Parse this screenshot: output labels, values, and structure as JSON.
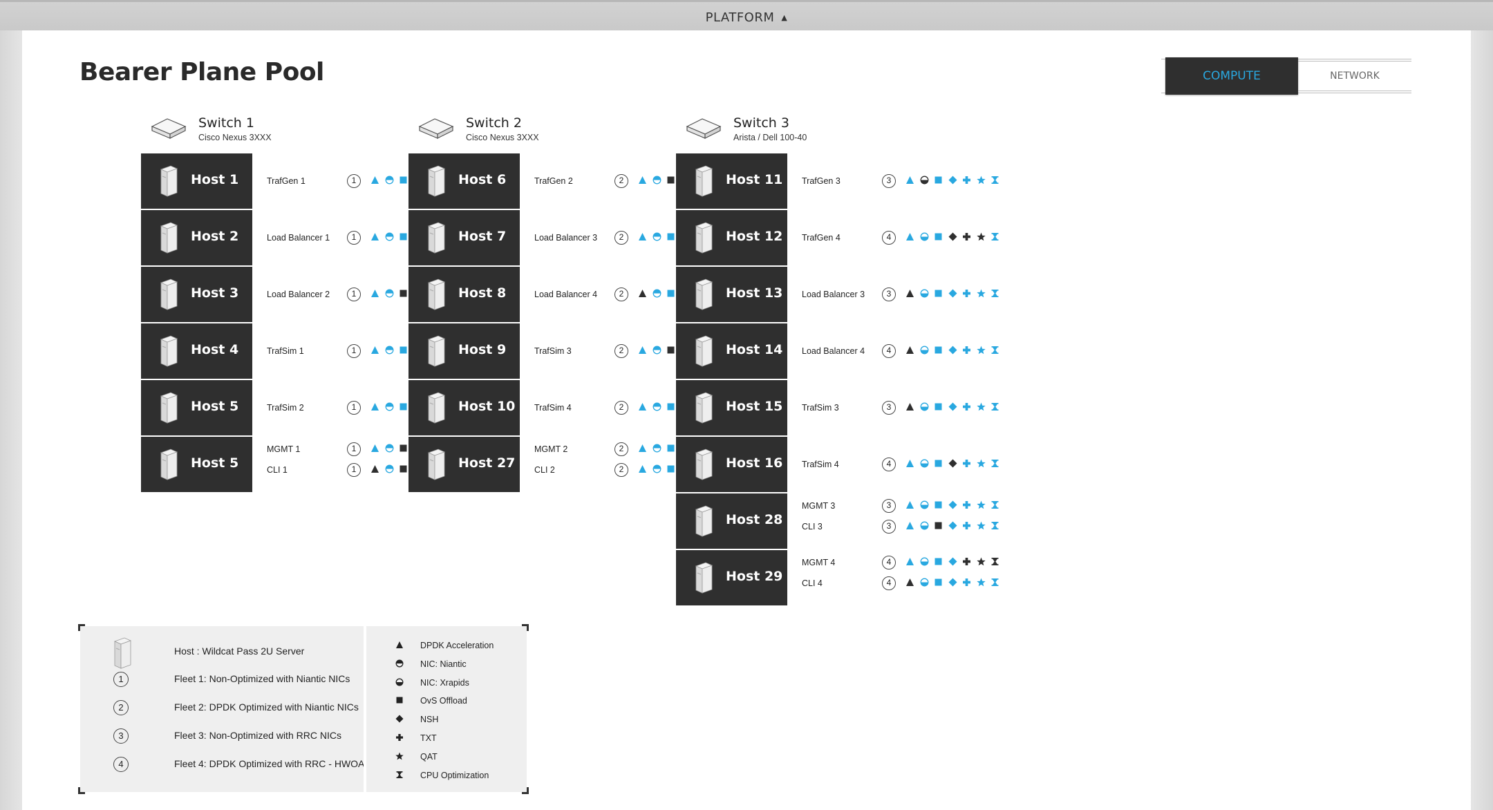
{
  "header": {
    "title": "PLATFORM",
    "caret_icon": "caret-up-icon"
  },
  "page": {
    "title": "Bearer Plane Pool"
  },
  "view_toggle": {
    "compute_label": "COMPUTE",
    "network_label": "NETWORK",
    "active": "COMPUTE"
  },
  "colors": {
    "accent": "#29a8e0",
    "dark": "#2f2f2f"
  },
  "capability_order": [
    "dpdk",
    "niantic",
    "square",
    "diamond",
    "plus",
    "star",
    "hourglass"
  ],
  "switches": [
    {
      "name": "Switch 1",
      "model": "Cisco Nexus 3XXX",
      "hosts": [
        {
          "name": "Host 1",
          "lines": [
            {
              "label": "TrafGen 1",
              "fleet": "1",
              "nic": "niantic",
              "dark": [
                3
              ]
            }
          ]
        },
        {
          "name": "Host 2",
          "lines": [
            {
              "label": "Load Balancer 1",
              "fleet": "1",
              "nic": "niantic",
              "dark": [
                3,
                6
              ]
            }
          ]
        },
        {
          "name": "Host 3",
          "lines": [
            {
              "label": "Load Balancer 2",
              "fleet": "1",
              "nic": "niantic",
              "dark": [
                2,
                3
              ]
            }
          ]
        },
        {
          "name": "Host 4",
          "lines": [
            {
              "label": "TrafSim 1",
              "fleet": "1",
              "nic": "niantic",
              "dark": [
                4
              ]
            }
          ]
        },
        {
          "name": "Host 5",
          "lines": [
            {
              "label": "TrafSim 2",
              "fleet": "1",
              "nic": "niantic",
              "dark": []
            }
          ]
        },
        {
          "name": "Host 5",
          "lines": [
            {
              "label": "MGMT 1",
              "fleet": "1",
              "nic": "niantic",
              "dark": [
                2
              ]
            },
            {
              "label": "CLI 1",
              "fleet": "1",
              "nic": "niantic",
              "dark": [
                0,
                2,
                3
              ]
            }
          ]
        }
      ]
    },
    {
      "name": "Switch 2",
      "model": "Cisco Nexus 3XXX",
      "hosts": [
        {
          "name": "Host 6",
          "lines": [
            {
              "label": "TrafGen 2",
              "fleet": "2",
              "nic": "niantic",
              "dark": [
                2
              ]
            }
          ]
        },
        {
          "name": "Host 7",
          "lines": [
            {
              "label": "Load Balancer 3",
              "fleet": "2",
              "nic": "niantic",
              "dark": [
                3
              ]
            }
          ]
        },
        {
          "name": "Host 8",
          "lines": [
            {
              "label": "Load Balancer 4",
              "fleet": "2",
              "nic": "niantic",
              "dark": [
                0
              ]
            }
          ]
        },
        {
          "name": "Host 9",
          "lines": [
            {
              "label": "TrafSim 3",
              "fleet": "2",
              "nic": "niantic",
              "dark": [
                2,
                3,
                6
              ]
            }
          ]
        },
        {
          "name": "Host 10",
          "lines": [
            {
              "label": "TrafSim 4",
              "fleet": "2",
              "nic": "niantic",
              "dark": [
                4,
                6
              ]
            }
          ]
        },
        {
          "name": "Host 27",
          "lines": [
            {
              "label": "MGMT 2",
              "fleet": "2",
              "nic": "niantic",
              "dark": [
                5,
                6
              ]
            },
            {
              "label": "CLI 2",
              "fleet": "2",
              "nic": "niantic",
              "dark": [
                5,
                6
              ]
            }
          ]
        }
      ]
    },
    {
      "name": "Switch 3",
      "model": "Arista / Dell 100-40",
      "hosts": [
        {
          "name": "Host 11",
          "lines": [
            {
              "label": "TrafGen 3",
              "fleet": "3",
              "nic": "xrapids",
              "dark": [
                1
              ]
            }
          ]
        },
        {
          "name": "Host 12",
          "lines": [
            {
              "label": "TrafGen 4",
              "fleet": "4",
              "nic": "xrapids",
              "dark": [
                3,
                4,
                5
              ]
            }
          ]
        },
        {
          "name": "Host 13",
          "lines": [
            {
              "label": "Load Balancer 3",
              "fleet": "3",
              "nic": "xrapids",
              "dark": [
                0
              ]
            }
          ]
        },
        {
          "name": "Host 14",
          "lines": [
            {
              "label": "Load Balancer 4",
              "fleet": "4",
              "nic": "xrapids",
              "dark": [
                0
              ]
            }
          ]
        },
        {
          "name": "Host 15",
          "lines": [
            {
              "label": "TrafSim 3",
              "fleet": "3",
              "nic": "xrapids",
              "dark": [
                0
              ]
            }
          ]
        },
        {
          "name": "Host 16",
          "lines": [
            {
              "label": "TrafSim 4",
              "fleet": "4",
              "nic": "xrapids",
              "dark": [
                3
              ]
            }
          ]
        },
        {
          "name": "Host 28",
          "lines": [
            {
              "label": "MGMT 3",
              "fleet": "3",
              "nic": "xrapids",
              "dark": []
            },
            {
              "label": "CLI 3",
              "fleet": "3",
              "nic": "xrapids",
              "dark": [
                2
              ]
            }
          ]
        },
        {
          "name": "Host 29",
          "lines": [
            {
              "label": "MGMT 4",
              "fleet": "4",
              "nic": "xrapids",
              "dark": [
                4,
                5,
                6
              ]
            },
            {
              "label": "CLI 4",
              "fleet": "4",
              "nic": "xrapids",
              "dark": [
                0
              ]
            }
          ]
        }
      ]
    }
  ],
  "legend": {
    "host": "Host : Wildcat Pass 2U Server",
    "fleets": [
      {
        "num": "1",
        "text": "Fleet 1: Non-Optimized with Niantic NICs"
      },
      {
        "num": "2",
        "text": "Fleet 2: DPDK Optimized with Niantic NICs"
      },
      {
        "num": "3",
        "text": "Fleet 3: Non-Optimized with RRC NICs"
      },
      {
        "num": "4",
        "text": "Fleet 4: DPDK Optimized with RRC - HWOA"
      }
    ],
    "capabilities": [
      {
        "icon": "triangle-icon",
        "shape": "dpdk",
        "text": "DPDK Acceleration"
      },
      {
        "icon": "half-circle-top-icon",
        "shape": "niantic",
        "text": "NIC: Niantic"
      },
      {
        "icon": "half-circle-bottom-icon",
        "shape": "xrapids",
        "text": "NIC: Xrapids"
      },
      {
        "icon": "square-icon",
        "shape": "square",
        "text": "OvS Offload"
      },
      {
        "icon": "diamond-icon",
        "shape": "diamond",
        "text": "NSH"
      },
      {
        "icon": "plus-icon",
        "shape": "plus",
        "text": "TXT"
      },
      {
        "icon": "star-icon",
        "shape": "star",
        "text": "QAT"
      },
      {
        "icon": "hourglass-icon",
        "shape": "hourglass",
        "text": "CPU Optimization"
      }
    ]
  }
}
